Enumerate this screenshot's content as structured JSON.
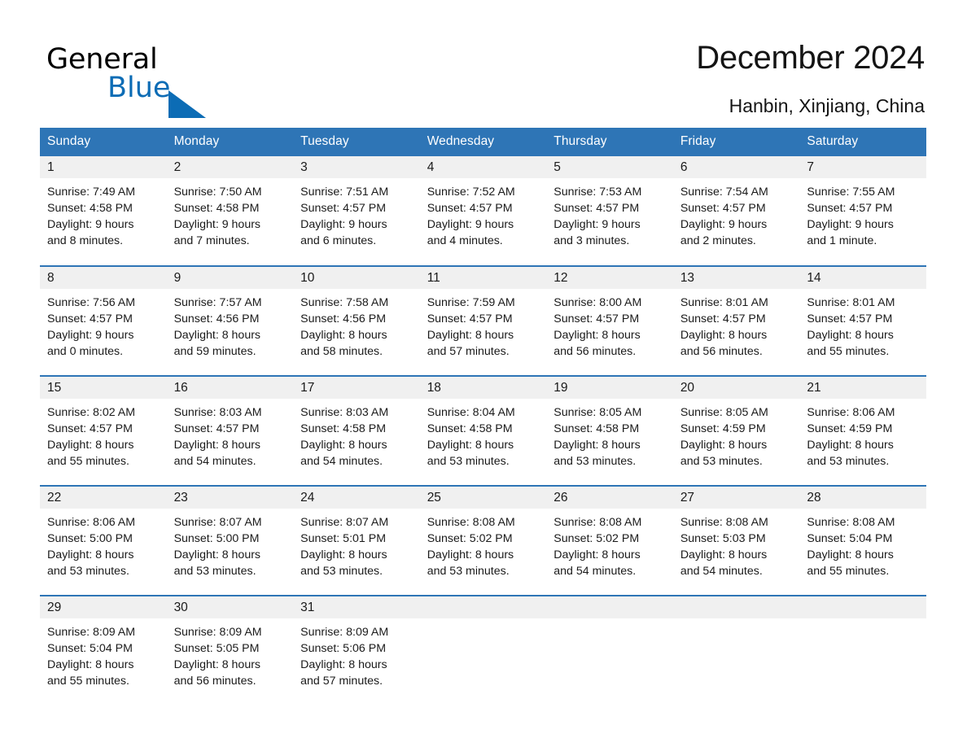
{
  "brand": {
    "name_part1": "General",
    "name_part2": "Blue",
    "triangle_color": "#0C6CB5",
    "text_color": "#000000"
  },
  "header": {
    "title": "December 2024",
    "subtitle": "Hanbin, Xinjiang, China"
  },
  "theme": {
    "header_bg": "#2E75B6",
    "header_text": "#FFFFFF",
    "daynum_bg": "#F0F0F0",
    "row_border": "#2E75B6",
    "body_text": "#1A1A1A"
  },
  "calendar": {
    "weekday_headers": [
      "Sunday",
      "Monday",
      "Tuesday",
      "Wednesday",
      "Thursday",
      "Friday",
      "Saturday"
    ],
    "weeks": [
      [
        {
          "day": "1",
          "sunrise": "Sunrise: 7:49 AM",
          "sunset": "Sunset: 4:58 PM",
          "daylight1": "Daylight: 9 hours",
          "daylight2": "and 8 minutes."
        },
        {
          "day": "2",
          "sunrise": "Sunrise: 7:50 AM",
          "sunset": "Sunset: 4:58 PM",
          "daylight1": "Daylight: 9 hours",
          "daylight2": "and 7 minutes."
        },
        {
          "day": "3",
          "sunrise": "Sunrise: 7:51 AM",
          "sunset": "Sunset: 4:57 PM",
          "daylight1": "Daylight: 9 hours",
          "daylight2": "and 6 minutes."
        },
        {
          "day": "4",
          "sunrise": "Sunrise: 7:52 AM",
          "sunset": "Sunset: 4:57 PM",
          "daylight1": "Daylight: 9 hours",
          "daylight2": "and 4 minutes."
        },
        {
          "day": "5",
          "sunrise": "Sunrise: 7:53 AM",
          "sunset": "Sunset: 4:57 PM",
          "daylight1": "Daylight: 9 hours",
          "daylight2": "and 3 minutes."
        },
        {
          "day": "6",
          "sunrise": "Sunrise: 7:54 AM",
          "sunset": "Sunset: 4:57 PM",
          "daylight1": "Daylight: 9 hours",
          "daylight2": "and 2 minutes."
        },
        {
          "day": "7",
          "sunrise": "Sunrise: 7:55 AM",
          "sunset": "Sunset: 4:57 PM",
          "daylight1": "Daylight: 9 hours",
          "daylight2": "and 1 minute."
        }
      ],
      [
        {
          "day": "8",
          "sunrise": "Sunrise: 7:56 AM",
          "sunset": "Sunset: 4:57 PM",
          "daylight1": "Daylight: 9 hours",
          "daylight2": "and 0 minutes."
        },
        {
          "day": "9",
          "sunrise": "Sunrise: 7:57 AM",
          "sunset": "Sunset: 4:56 PM",
          "daylight1": "Daylight: 8 hours",
          "daylight2": "and 59 minutes."
        },
        {
          "day": "10",
          "sunrise": "Sunrise: 7:58 AM",
          "sunset": "Sunset: 4:56 PM",
          "daylight1": "Daylight: 8 hours",
          "daylight2": "and 58 minutes."
        },
        {
          "day": "11",
          "sunrise": "Sunrise: 7:59 AM",
          "sunset": "Sunset: 4:57 PM",
          "daylight1": "Daylight: 8 hours",
          "daylight2": "and 57 minutes."
        },
        {
          "day": "12",
          "sunrise": "Sunrise: 8:00 AM",
          "sunset": "Sunset: 4:57 PM",
          "daylight1": "Daylight: 8 hours",
          "daylight2": "and 56 minutes."
        },
        {
          "day": "13",
          "sunrise": "Sunrise: 8:01 AM",
          "sunset": "Sunset: 4:57 PM",
          "daylight1": "Daylight: 8 hours",
          "daylight2": "and 56 minutes."
        },
        {
          "day": "14",
          "sunrise": "Sunrise: 8:01 AM",
          "sunset": "Sunset: 4:57 PM",
          "daylight1": "Daylight: 8 hours",
          "daylight2": "and 55 minutes."
        }
      ],
      [
        {
          "day": "15",
          "sunrise": "Sunrise: 8:02 AM",
          "sunset": "Sunset: 4:57 PM",
          "daylight1": "Daylight: 8 hours",
          "daylight2": "and 55 minutes."
        },
        {
          "day": "16",
          "sunrise": "Sunrise: 8:03 AM",
          "sunset": "Sunset: 4:57 PM",
          "daylight1": "Daylight: 8 hours",
          "daylight2": "and 54 minutes."
        },
        {
          "day": "17",
          "sunrise": "Sunrise: 8:03 AM",
          "sunset": "Sunset: 4:58 PM",
          "daylight1": "Daylight: 8 hours",
          "daylight2": "and 54 minutes."
        },
        {
          "day": "18",
          "sunrise": "Sunrise: 8:04 AM",
          "sunset": "Sunset: 4:58 PM",
          "daylight1": "Daylight: 8 hours",
          "daylight2": "and 53 minutes."
        },
        {
          "day": "19",
          "sunrise": "Sunrise: 8:05 AM",
          "sunset": "Sunset: 4:58 PM",
          "daylight1": "Daylight: 8 hours",
          "daylight2": "and 53 minutes."
        },
        {
          "day": "20",
          "sunrise": "Sunrise: 8:05 AM",
          "sunset": "Sunset: 4:59 PM",
          "daylight1": "Daylight: 8 hours",
          "daylight2": "and 53 minutes."
        },
        {
          "day": "21",
          "sunrise": "Sunrise: 8:06 AM",
          "sunset": "Sunset: 4:59 PM",
          "daylight1": "Daylight: 8 hours",
          "daylight2": "and 53 minutes."
        }
      ],
      [
        {
          "day": "22",
          "sunrise": "Sunrise: 8:06 AM",
          "sunset": "Sunset: 5:00 PM",
          "daylight1": "Daylight: 8 hours",
          "daylight2": "and 53 minutes."
        },
        {
          "day": "23",
          "sunrise": "Sunrise: 8:07 AM",
          "sunset": "Sunset: 5:00 PM",
          "daylight1": "Daylight: 8 hours",
          "daylight2": "and 53 minutes."
        },
        {
          "day": "24",
          "sunrise": "Sunrise: 8:07 AM",
          "sunset": "Sunset: 5:01 PM",
          "daylight1": "Daylight: 8 hours",
          "daylight2": "and 53 minutes."
        },
        {
          "day": "25",
          "sunrise": "Sunrise: 8:08 AM",
          "sunset": "Sunset: 5:02 PM",
          "daylight1": "Daylight: 8 hours",
          "daylight2": "and 53 minutes."
        },
        {
          "day": "26",
          "sunrise": "Sunrise: 8:08 AM",
          "sunset": "Sunset: 5:02 PM",
          "daylight1": "Daylight: 8 hours",
          "daylight2": "and 54 minutes."
        },
        {
          "day": "27",
          "sunrise": "Sunrise: 8:08 AM",
          "sunset": "Sunset: 5:03 PM",
          "daylight1": "Daylight: 8 hours",
          "daylight2": "and 54 minutes."
        },
        {
          "day": "28",
          "sunrise": "Sunrise: 8:08 AM",
          "sunset": "Sunset: 5:04 PM",
          "daylight1": "Daylight: 8 hours",
          "daylight2": "and 55 minutes."
        }
      ],
      [
        {
          "day": "29",
          "sunrise": "Sunrise: 8:09 AM",
          "sunset": "Sunset: 5:04 PM",
          "daylight1": "Daylight: 8 hours",
          "daylight2": "and 55 minutes."
        },
        {
          "day": "30",
          "sunrise": "Sunrise: 8:09 AM",
          "sunset": "Sunset: 5:05 PM",
          "daylight1": "Daylight: 8 hours",
          "daylight2": "and 56 minutes."
        },
        {
          "day": "31",
          "sunrise": "Sunrise: 8:09 AM",
          "sunset": "Sunset: 5:06 PM",
          "daylight1": "Daylight: 8 hours",
          "daylight2": "and 57 minutes."
        },
        {
          "day": "",
          "sunrise": "",
          "sunset": "",
          "daylight1": "",
          "daylight2": ""
        },
        {
          "day": "",
          "sunrise": "",
          "sunset": "",
          "daylight1": "",
          "daylight2": ""
        },
        {
          "day": "",
          "sunrise": "",
          "sunset": "",
          "daylight1": "",
          "daylight2": ""
        },
        {
          "day": "",
          "sunrise": "",
          "sunset": "",
          "daylight1": "",
          "daylight2": ""
        }
      ]
    ]
  }
}
